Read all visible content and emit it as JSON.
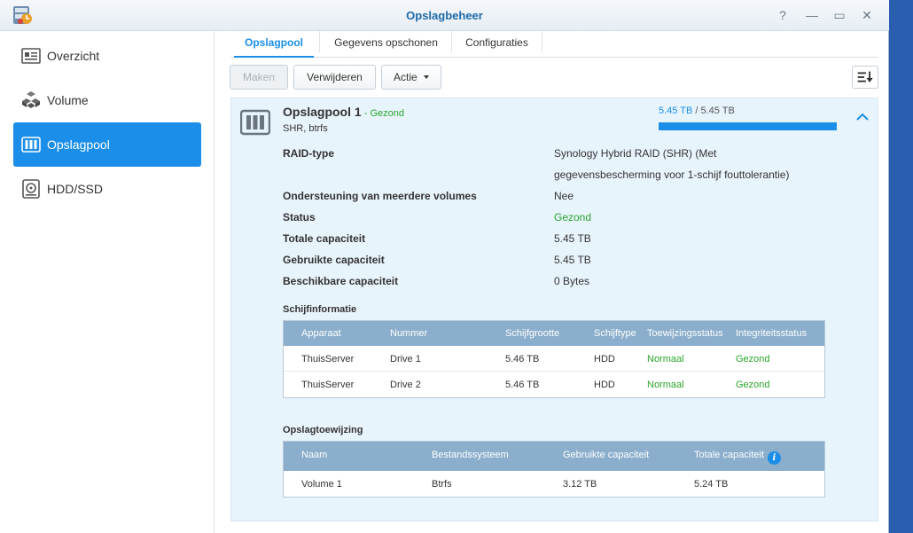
{
  "window": {
    "title": "Opslagbeheer",
    "help_glyph": "?",
    "minimize_glyph": "—",
    "maximize_glyph": "▭",
    "close_glyph": "✕"
  },
  "sidebar": {
    "items": [
      {
        "label": "Overzicht",
        "icon": "overview-icon"
      },
      {
        "label": "Volume",
        "icon": "volume-icon"
      },
      {
        "label": "Opslagpool",
        "icon": "storage-pool-icon",
        "active": true
      },
      {
        "label": "HDD/SSD",
        "icon": "disk-icon"
      }
    ]
  },
  "tabs": [
    {
      "label": "Opslagpool",
      "active": true
    },
    {
      "label": "Gegevens opschonen"
    },
    {
      "label": "Configuraties"
    }
  ],
  "toolbar": {
    "create_label": "Maken",
    "delete_label": "Verwijderen",
    "action_label": "Actie"
  },
  "pool": {
    "name": "Opslagpool 1",
    "status": " - Gezond",
    "subtitle": "SHR, btrfs",
    "capacity_used": "5.45 TB",
    "capacity_total": " / 5.45 TB",
    "usage_fraction": 1.0,
    "details": [
      {
        "label": "RAID-type",
        "value": "Synology Hybrid RAID (SHR) (Met",
        "value2": "gegevensbescherming voor 1-schijf fouttolerantie)"
      },
      {
        "label": "Ondersteuning van meerdere volumes",
        "value": "Nee"
      },
      {
        "label": "Status",
        "value": "Gezond"
      },
      {
        "label": "Totale capaciteit",
        "value": "5.45 TB"
      },
      {
        "label": "Gebruikte capaciteit",
        "value": "5.45 TB"
      },
      {
        "label": "Beschikbare capaciteit",
        "value": "0 Bytes"
      }
    ]
  },
  "disk_info": {
    "title": "Schijfinformatie",
    "columns": [
      "Apparaat",
      "Nummer",
      "Schijfgrootte",
      "Schijftype",
      "Toewijzingsstatus",
      "Integriteitsstatus"
    ],
    "rows": [
      [
        "ThuisServer",
        "Drive 1",
        "5.46 TB",
        "HDD",
        "Normaal",
        "Gezond"
      ],
      [
        "ThuisServer",
        "Drive 2",
        "5.46 TB",
        "HDD",
        "Normaal",
        "Gezond"
      ]
    ]
  },
  "allocation": {
    "title": "Opslagtoewijzing",
    "columns": [
      "Naam",
      "Bestandssysteem",
      "Gebruikte capaciteit",
      "Totale capaciteit"
    ],
    "rows": [
      [
        "Volume 1",
        "Btrfs",
        "3.12 TB",
        "5.24 TB"
      ]
    ],
    "info_glyph": "i"
  },
  "colors": {
    "accent": "#1a8ee8",
    "healthy": "#2aa52a",
    "grid_header": "#8aaecb",
    "panel_bg": "#e8f4fc"
  }
}
